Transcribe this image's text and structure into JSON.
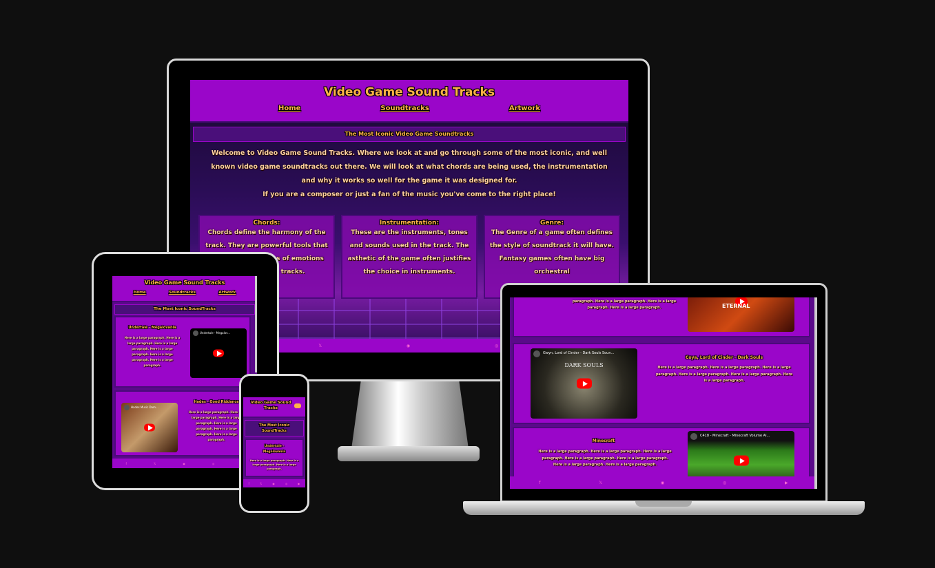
{
  "site": {
    "title": "Video Game Sound Tracks",
    "nav": [
      "Home",
      "Soundtracks",
      "Artwork"
    ],
    "subtitle": "The Most Iconic Video Game Soundtracks",
    "subtitle_tablet": "The Most Iconic SoundTracks",
    "subtitle_phone": "The Most Iconic SoundTracks",
    "intro_1": "Welcome to Video Game Sound Tracks. Where we look at and go through some of the most iconic, and well known video game soundtracks out there. We will look at what chords are being used, the instrumentation and why it works so well for the game it was designed for.",
    "intro_2": "If you are a composer or just a fan of the music you've come to the right place!",
    "cards": [
      {
        "heading": "Chords:",
        "text": "Chords define the harmony of the track. They are powerful tools that create certain types of emotions used for game tracks."
      },
      {
        "heading": "Instrumentation:",
        "text": "These are the instruments, tones and sounds used in the track. The asthetic of the game often justifies the choice in instruments."
      },
      {
        "heading": "Genre:",
        "text": "The Genre of a game often defines the style of soundtrack it will have. Fantasy games often have big orchestral"
      }
    ],
    "footer_icons": [
      "facebook-icon",
      "x-icon",
      "discord-icon",
      "instagram-icon",
      "youtube-icon"
    ]
  },
  "tablet": {
    "tracks": [
      {
        "name": "Undertale - Megalovania",
        "video_title": "Undertale - Megalov...",
        "text": "Here is a large paragraph. Here is a large paragraph. Here is a large paragraph. Here is a large paragraph. Here is a large paragraph. Here is a large paragraph."
      },
      {
        "name": "Hades - Good Riddance",
        "video_title": "Hades Music Dam...",
        "text": "Here is a large paragraph. Here is a large paragraph. Here is a large paragraph. Here is a large paragraph. Here is a large paragraph. Here is a large paragraph."
      }
    ]
  },
  "phone": {
    "track": "Undertale - Megalovania",
    "text": "Here is a large paragraph. Here is a large paragraph. Here is a large paragraph."
  },
  "laptop": {
    "top_text": "paragraph. Here is a large paragraph. Here is a large paragraph. Here is a large paragraph.",
    "top_video_label": "ETERNAL",
    "tracks": [
      {
        "name": "Coya, Lord of Cinder - Dark Souls",
        "video_title": "Gwyn, Lord of Cinder - Dark Souls Soun...",
        "video_label": "DARK SOULS",
        "text": "Here is a large paragraph. Here is a large paragraph. Here is a large paragraph. Here is a large paragraph. Here is a large paragraph. Here is a large paragraph."
      },
      {
        "name": "Minecraft",
        "video_title": "C418 - Minecraft - Minecraft Volume Al...",
        "text": "Here is a large paragraph. Here is a large paragraph. Here is a large paragraph. Here is a large paragraph. Here is a large paragraph. Here is a large paragraph. Here is a large paragraph."
      }
    ]
  },
  "colors": {
    "background": "#0f0f0f",
    "header": "#9a06c9",
    "title": "#ffb347",
    "footer_icon": "#ff6ad5"
  }
}
